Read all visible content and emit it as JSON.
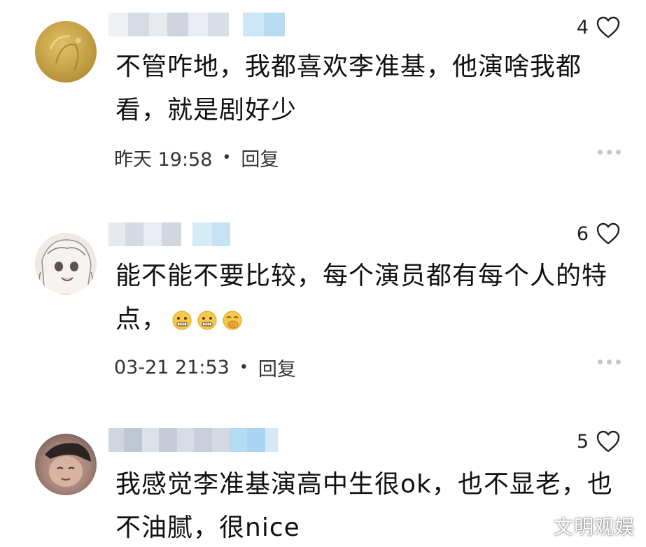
{
  "comments": [
    {
      "text": "不管咋地，我都喜欢李准基，他演啥我都看，就是剧好少",
      "likes": "4",
      "time": "昨天 19:58",
      "reply_label": "回复",
      "avatar_color": "#c9a54a"
    },
    {
      "text": "能不能不要比较，每个演员都有每个人的特点，",
      "likes": "6",
      "time": "03-21 21:53",
      "reply_label": "回复",
      "emojis": [
        "grimace-emoji",
        "grimace-emoji",
        "hand-over-mouth-emoji"
      ],
      "avatar_color": "#e8e4e2"
    },
    {
      "text": "我感觉李准基演高中生很ok，也不显老，也不油腻，很nice",
      "likes": "5",
      "avatar_color": "#a7857a"
    }
  ],
  "watermark": "文明观娱",
  "colors": {
    "like_icon": "#222222",
    "more_dots": "#c6c6c6",
    "username_blur_gray": "#d3d8e2",
    "username_blur_blue": "#bfe0f5"
  }
}
